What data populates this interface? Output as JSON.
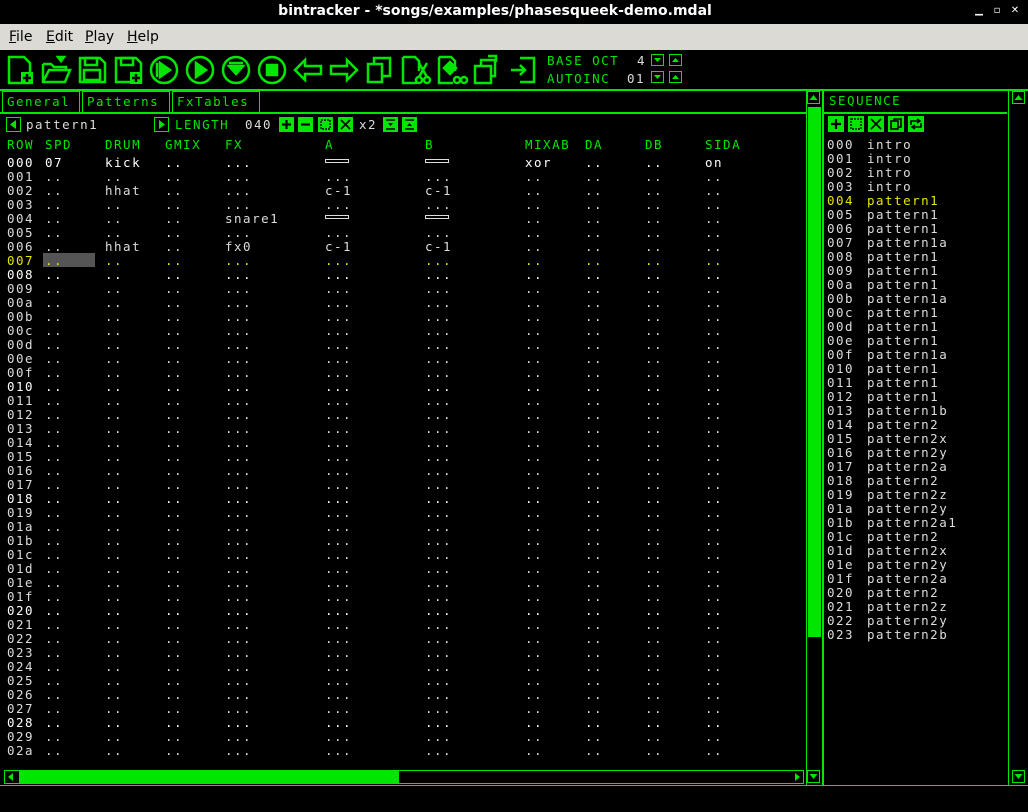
{
  "window": {
    "title": "bintracker - *songs/examples/phasesqueek-demo.mdal"
  },
  "menu": [
    {
      "label": "File",
      "u": "F",
      "rest": "ile"
    },
    {
      "label": "Edit",
      "u": "E",
      "rest": "dit"
    },
    {
      "label": "Play",
      "u": "P",
      "rest": "lay"
    },
    {
      "label": "Help",
      "u": "H",
      "rest": "elp"
    }
  ],
  "toolbar": {
    "base_oct_label": "BASE OCT",
    "base_oct_value": "4",
    "autoinc_label": "AUTOINC",
    "autoinc_value": "01",
    "icons": [
      "new-file-icon",
      "open-folder-icon",
      "save-icon",
      "save-as-icon",
      "play-icon",
      "play-from-start-icon",
      "play-pattern-icon",
      "stop-icon",
      "undo-icon",
      "redo-icon",
      "copy-icon",
      "cut-icon",
      "clear-icon",
      "paste-icon",
      "insert-icon"
    ]
  },
  "tabs": [
    {
      "label": "General"
    },
    {
      "label": "Patterns"
    },
    {
      "label": "FxTables"
    }
  ],
  "pattern": {
    "name": "pattern1",
    "length_label": "LENGTH",
    "length_value": "040",
    "multiplier": "x2",
    "columns": [
      "ROW",
      "SPD",
      "DRUM",
      "GMIX",
      "FX",
      "A",
      "B",
      "MIXAB",
      "DA",
      "DB",
      "SIDA"
    ],
    "current_row": "007",
    "rows": [
      [
        "000",
        "07",
        "kick",
        "..",
        "...",
        "BAR",
        "BAR",
        "xor",
        "..",
        "..",
        "on"
      ],
      [
        "001",
        "..",
        "..",
        "..",
        "...",
        "...",
        "...",
        "..",
        "..",
        "..",
        ".."
      ],
      [
        "002",
        "..",
        "hhat",
        "..",
        "...",
        "c-1",
        "c-1",
        "..",
        "..",
        "..",
        ".."
      ],
      [
        "003",
        "..",
        "..",
        "..",
        "...",
        "...",
        "...",
        "..",
        "..",
        "..",
        ".."
      ],
      [
        "004",
        "..",
        "..",
        "..",
        "snare1",
        "BAR",
        "BAR",
        "..",
        "..",
        "..",
        ".."
      ],
      [
        "005",
        "..",
        "..",
        "..",
        "...",
        "...",
        "...",
        "..",
        "..",
        "..",
        ".."
      ],
      [
        "006",
        "..",
        "hhat",
        "..",
        "fx0",
        "c-1",
        "c-1",
        "..",
        "..",
        "..",
        ".."
      ],
      [
        "007",
        "..",
        "..",
        "..",
        "...",
        "...",
        "...",
        "..",
        "..",
        "..",
        ".."
      ],
      [
        "008",
        "..",
        "..",
        "..",
        "...",
        "...",
        "...",
        "..",
        "..",
        "..",
        ".."
      ],
      [
        "009",
        "..",
        "..",
        "..",
        "...",
        "...",
        "...",
        "..",
        "..",
        "..",
        ".."
      ],
      [
        "00a",
        "..",
        "..",
        "..",
        "...",
        "...",
        "...",
        "..",
        "..",
        "..",
        ".."
      ],
      [
        "00b",
        "..",
        "..",
        "..",
        "...",
        "...",
        "...",
        "..",
        "..",
        "..",
        ".."
      ],
      [
        "00c",
        "..",
        "..",
        "..",
        "...",
        "...",
        "...",
        "..",
        "..",
        "..",
        ".."
      ],
      [
        "00d",
        "..",
        "..",
        "..",
        "...",
        "...",
        "...",
        "..",
        "..",
        "..",
        ".."
      ],
      [
        "00e",
        "..",
        "..",
        "..",
        "...",
        "...",
        "...",
        "..",
        "..",
        "..",
        ".."
      ],
      [
        "00f",
        "..",
        "..",
        "..",
        "...",
        "...",
        "...",
        "..",
        "..",
        "..",
        ".."
      ],
      [
        "010",
        "..",
        "..",
        "..",
        "...",
        "...",
        "...",
        "..",
        "..",
        "..",
        ".."
      ],
      [
        "011",
        "..",
        "..",
        "..",
        "...",
        "...",
        "...",
        "..",
        "..",
        "..",
        ".."
      ],
      [
        "012",
        "..",
        "..",
        "..",
        "...",
        "...",
        "...",
        "..",
        "..",
        "..",
        ".."
      ],
      [
        "013",
        "..",
        "..",
        "..",
        "...",
        "...",
        "...",
        "..",
        "..",
        "..",
        ".."
      ],
      [
        "014",
        "..",
        "..",
        "..",
        "...",
        "...",
        "...",
        "..",
        "..",
        "..",
        ".."
      ],
      [
        "015",
        "..",
        "..",
        "..",
        "...",
        "...",
        "...",
        "..",
        "..",
        "..",
        ".."
      ],
      [
        "016",
        "..",
        "..",
        "..",
        "...",
        "...",
        "...",
        "..",
        "..",
        "..",
        ".."
      ],
      [
        "017",
        "..",
        "..",
        "..",
        "...",
        "...",
        "...",
        "..",
        "..",
        "..",
        ".."
      ],
      [
        "018",
        "..",
        "..",
        "..",
        "...",
        "...",
        "...",
        "..",
        "..",
        "..",
        ".."
      ],
      [
        "019",
        "..",
        "..",
        "..",
        "...",
        "...",
        "...",
        "..",
        "..",
        "..",
        ".."
      ],
      [
        "01a",
        "..",
        "..",
        "..",
        "...",
        "...",
        "...",
        "..",
        "..",
        "..",
        ".."
      ],
      [
        "01b",
        "..",
        "..",
        "..",
        "...",
        "...",
        "...",
        "..",
        "..",
        "..",
        ".."
      ],
      [
        "01c",
        "..",
        "..",
        "..",
        "...",
        "...",
        "...",
        "..",
        "..",
        "..",
        ".."
      ],
      [
        "01d",
        "..",
        "..",
        "..",
        "...",
        "...",
        "...",
        "..",
        "..",
        "..",
        ".."
      ],
      [
        "01e",
        "..",
        "..",
        "..",
        "...",
        "...",
        "...",
        "..",
        "..",
        "..",
        ".."
      ],
      [
        "01f",
        "..",
        "..",
        "..",
        "...",
        "...",
        "...",
        "..",
        "..",
        "..",
        ".."
      ],
      [
        "020",
        "..",
        "..",
        "..",
        "...",
        "...",
        "...",
        "..",
        "..",
        "..",
        ".."
      ],
      [
        "021",
        "..",
        "..",
        "..",
        "...",
        "...",
        "...",
        "..",
        "..",
        "..",
        ".."
      ],
      [
        "022",
        "..",
        "..",
        "..",
        "...",
        "...",
        "...",
        "..",
        "..",
        "..",
        ".."
      ],
      [
        "023",
        "..",
        "..",
        "..",
        "...",
        "...",
        "...",
        "..",
        "..",
        "..",
        ".."
      ],
      [
        "024",
        "..",
        "..",
        "..",
        "...",
        "...",
        "...",
        "..",
        "..",
        "..",
        ".."
      ],
      [
        "025",
        "..",
        "..",
        "..",
        "...",
        "...",
        "...",
        "..",
        "..",
        "..",
        ".."
      ],
      [
        "026",
        "..",
        "..",
        "..",
        "...",
        "...",
        "...",
        "..",
        "..",
        "..",
        ".."
      ],
      [
        "027",
        "..",
        "..",
        "..",
        "...",
        "...",
        "...",
        "..",
        "..",
        "..",
        ".."
      ],
      [
        "028",
        "..",
        "..",
        "..",
        "...",
        "...",
        "...",
        "..",
        "..",
        "..",
        ".."
      ],
      [
        "029",
        "..",
        "..",
        "..",
        "...",
        "...",
        "...",
        "..",
        "..",
        "..",
        ".."
      ],
      [
        "02a",
        "..",
        "..",
        "..",
        "...",
        "...",
        "...",
        "..",
        "..",
        "..",
        ".."
      ]
    ]
  },
  "sequence": {
    "title": "SEQUENCE",
    "current": "004",
    "rows": [
      [
        "000",
        "intro"
      ],
      [
        "001",
        "intro"
      ],
      [
        "002",
        "intro"
      ],
      [
        "003",
        "intro"
      ],
      [
        "004",
        "pattern1"
      ],
      [
        "005",
        "pattern1"
      ],
      [
        "006",
        "pattern1"
      ],
      [
        "007",
        "pattern1a"
      ],
      [
        "008",
        "pattern1"
      ],
      [
        "009",
        "pattern1"
      ],
      [
        "00a",
        "pattern1"
      ],
      [
        "00b",
        "pattern1a"
      ],
      [
        "00c",
        "pattern1"
      ],
      [
        "00d",
        "pattern1"
      ],
      [
        "00e",
        "pattern1"
      ],
      [
        "00f",
        "pattern1a"
      ],
      [
        "010",
        "pattern1"
      ],
      [
        "011",
        "pattern1"
      ],
      [
        "012",
        "pattern1"
      ],
      [
        "013",
        "pattern1b"
      ],
      [
        "014",
        "pattern2"
      ],
      [
        "015",
        "pattern2x"
      ],
      [
        "016",
        "pattern2y"
      ],
      [
        "017",
        "pattern2a"
      ],
      [
        "018",
        "pattern2"
      ],
      [
        "019",
        "pattern2z"
      ],
      [
        "01a",
        "pattern2y"
      ],
      [
        "01b",
        "pattern2a1"
      ],
      [
        "01c",
        "pattern2"
      ],
      [
        "01d",
        "pattern2x"
      ],
      [
        "01e",
        "pattern2y"
      ],
      [
        "01f",
        "pattern2a"
      ],
      [
        "020",
        "pattern2"
      ],
      [
        "021",
        "pattern2z"
      ],
      [
        "022",
        "pattern2y"
      ],
      [
        "023",
        "pattern2b"
      ]
    ]
  },
  "colors": {
    "accent": "#00e600",
    "highlight": "#e6e600",
    "text": "#dddddd",
    "background": "#000000"
  }
}
